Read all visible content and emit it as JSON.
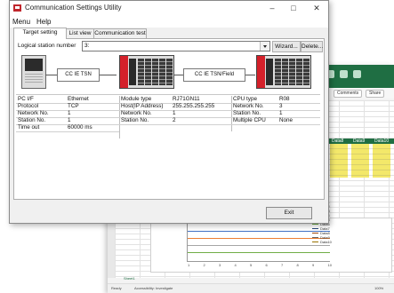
{
  "background_app": {
    "ribbon_buttons": [
      "Comments",
      "Share"
    ],
    "table_headers": [
      "Data8",
      "Data9",
      "Data10"
    ],
    "chart_x_ticks": [
      "1",
      "2",
      "3",
      "4",
      "5",
      "6",
      "7",
      "8",
      "9",
      "10"
    ],
    "legend": [
      "Data1",
      "Data2",
      "Data3",
      "Data4",
      "Data5",
      "Data6",
      "Data7",
      "Data8",
      "Data9",
      "Data10"
    ],
    "legend_colors": [
      "#4472c4",
      "#ed7d31",
      "#a5a5a5",
      "#ffc000",
      "#5b9bd5",
      "#70ad47",
      "#264478",
      "#9e480e",
      "#636363",
      "#997300"
    ],
    "status_left": "Ready",
    "status_accessibility": "Accessibility: Investigate",
    "sheet_tab": "Sheet1",
    "zoom": "100%"
  },
  "dialog": {
    "title": "Communication Settings Utility",
    "menu": [
      "Menu",
      "Help"
    ],
    "tabs": [
      "Target setting",
      "List view",
      "Communication test"
    ],
    "logical_station_label": "Logical station number",
    "logical_station_value": "3:",
    "wizard_label": "Wizard...",
    "delete_label": "Delete...",
    "net1_label": "CC IE TSN",
    "net2_label": "CC IE TSN/Field",
    "exit_label": "Exit"
  },
  "info": {
    "col1": [
      {
        "label": "PC I/F",
        "value": "Ethernet"
      },
      {
        "label": "Protocol",
        "value": "TCP"
      },
      {
        "label": "Network No.",
        "value": "1"
      },
      {
        "label": "Station No.",
        "value": "1"
      },
      {
        "label": "Time out",
        "value": "60000 ms"
      }
    ],
    "col2": [
      {
        "label": "Module type",
        "value": "RJ71GN11"
      },
      {
        "label": "Host(IP Address)",
        "value": "255.255.255.255"
      },
      {
        "label": "Network No.",
        "value": "1"
      },
      {
        "label": "Station No.",
        "value": "2"
      }
    ],
    "col3": [
      {
        "label": "CPU type",
        "value": "R08"
      },
      {
        "label": "Network No.",
        "value": "3"
      },
      {
        "label": "Station No.",
        "value": "1"
      },
      {
        "label": "Multiple CPU",
        "value": "None"
      }
    ]
  }
}
